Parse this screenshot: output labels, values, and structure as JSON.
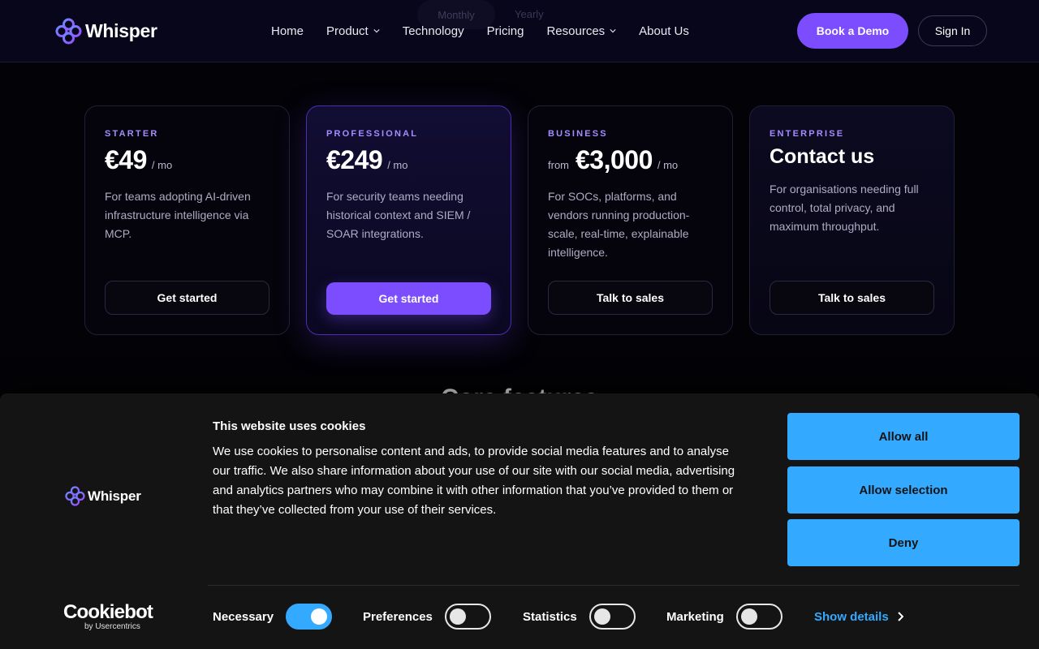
{
  "header": {
    "brand": "Whisper",
    "toggle_ghost_label": "Monthly",
    "toggle_ghost_alt": "Yearly",
    "nav": [
      {
        "label": "Home"
      },
      {
        "label": "Product",
        "has_dropdown": true
      },
      {
        "label": "Technology"
      },
      {
        "label": "Pricing"
      },
      {
        "label": "Resources",
        "has_dropdown": true
      },
      {
        "label": "About Us"
      }
    ],
    "demo_label": "Book a Demo",
    "signin_label": "Sign In"
  },
  "plans": [
    {
      "tier": "STARTER",
      "price": "€49",
      "per": "/ mo",
      "desc": "For teams adopting AI-driven infrastructure intelligence via MCP.",
      "cta": "Get started"
    },
    {
      "tier": "PROFESSIONAL",
      "price": "€249",
      "per": "/ mo",
      "desc": "For security teams needing historical context and SIEM / SOAR integrations.",
      "cta": "Get started"
    },
    {
      "tier": "BUSINESS",
      "from": "from",
      "price": "€3,000",
      "per": "/ mo",
      "desc": "For SOCs, platforms, and vendors running production-scale, real-time, explainable intelligence.",
      "cta": "Talk to sales"
    },
    {
      "tier": "ENTERPRISE",
      "price": "Contact us",
      "desc": "For organisations needing full control, total privacy, and maximum throughput.",
      "cta": "Talk to sales"
    }
  ],
  "section_peek": "Core features",
  "cookie": {
    "brand": "Whisper",
    "title": "This website uses cookies",
    "body": "We use cookies to personalise content and ads, to provide social media features and to analyse our traffic. We also share information about your use of our site with our social media, advertising and analytics partners who may combine it with other information that you’ve provided to them or that they’ve collected from your use of their services.",
    "allow_all": "Allow all",
    "allow_selection": "Allow selection",
    "deny": "Deny",
    "cookiebot_main": "Cookiebot",
    "cookiebot_sub": "by Usercentrics",
    "toggles": [
      {
        "label": "Necessary",
        "on": true
      },
      {
        "label": "Preferences",
        "on": false
      },
      {
        "label": "Statistics",
        "on": false
      },
      {
        "label": "Marketing",
        "on": false
      }
    ],
    "show_details": "Show details"
  },
  "colors": {
    "accent": "#7c4dff",
    "tier_label": "#a48cff",
    "cookie_accent": "#33a9ff",
    "banner_bg": "#141414"
  },
  "icons": [
    "whisper-logo-icon",
    "chevron-down-icon",
    "chevron-right-icon"
  ]
}
